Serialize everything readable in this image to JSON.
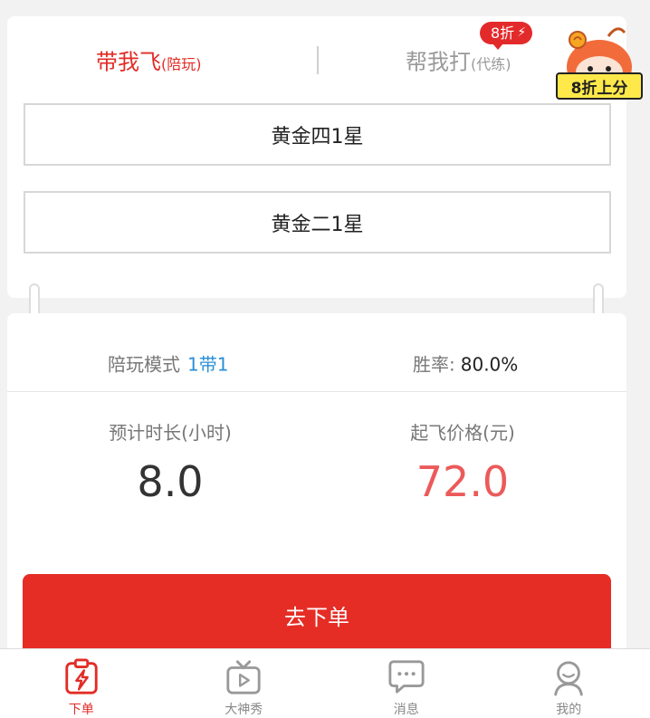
{
  "tabs": {
    "left": {
      "main": "带我飞",
      "sub": "(陪玩)"
    },
    "right": {
      "main": "帮我打",
      "sub": "(代练)"
    },
    "discount_badge": "8折",
    "discount_bolt": "⚡"
  },
  "mascot": {
    "label": "8折上分"
  },
  "ranks": {
    "current": "黄金四1星",
    "target": "黄金二1星"
  },
  "info": {
    "mode_label": "陪玩模式",
    "mode_value": "1带1",
    "rate_label": "胜率:",
    "rate_value": "80.0%"
  },
  "stats": {
    "duration_label": "预计时长(小时)",
    "duration_value": "8.0",
    "price_label": "起飞价格(元)",
    "price_value": "72.0"
  },
  "submit_label": "去下单",
  "nav": [
    {
      "label": "下单",
      "icon": "order-bolt-icon",
      "active": true
    },
    {
      "label": "大神秀",
      "icon": "tv-play-icon",
      "active": false
    },
    {
      "label": "消息",
      "icon": "message-bubble-icon",
      "active": false
    },
    {
      "label": "我的",
      "icon": "profile-icon",
      "active": false
    }
  ],
  "colors": {
    "accent": "#e22c26",
    "link_blue": "#2b8fd8",
    "price_red": "#ec5a5a"
  }
}
